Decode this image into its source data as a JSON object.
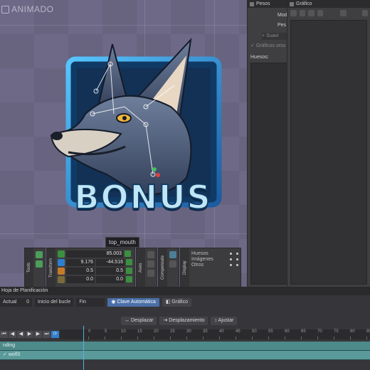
{
  "viewport": {
    "mode_label": "ANIMADO",
    "bone_label": "top_mouth",
    "artwork_text": "BONUS"
  },
  "transform_panel": {
    "tools_label": "Tools",
    "transform_label": "Transform",
    "axes_label": "Axes",
    "compensate_label": "Compensate",
    "display_label": "Display",
    "rotation": "85.003",
    "translate_x": "9.176",
    "translate_y": "-44.516",
    "scale_x": "0.5",
    "scale_y": "0.5",
    "shear_x": "0.0",
    "shear_y": "0.0",
    "layers": [
      "Huesos",
      "Imágenes",
      "Otros"
    ]
  },
  "pesos_panel": {
    "tab": "Pesos",
    "mode_label": "Mod",
    "weight_label": "Pes",
    "smooth_button": "Suavi",
    "graphics_check": "Gráficos orsu",
    "bones_label": "Huesos:"
  },
  "grafico_panel": {
    "tab": "Gráfico"
  },
  "timeline": {
    "title": "Hoja de Planificación",
    "current_label": "Actual",
    "current_value": "0",
    "loop_start": "Inicio del bucle",
    "end_label": "Fin",
    "auto_key": "Clave Automática",
    "graph_button": "Gráfico",
    "offset_button": "Desplazar",
    "shift_button": "Desplazamiento",
    "adjust_button": "Ajustar",
    "ruler_ticks": [
      "0",
      "5",
      "10",
      "15",
      "20",
      "25",
      "30",
      "35",
      "40",
      "45",
      "50",
      "55",
      "60",
      "65",
      "70",
      "75",
      "80",
      "85"
    ],
    "tracks": [
      "nding",
      "wolf3"
    ]
  }
}
